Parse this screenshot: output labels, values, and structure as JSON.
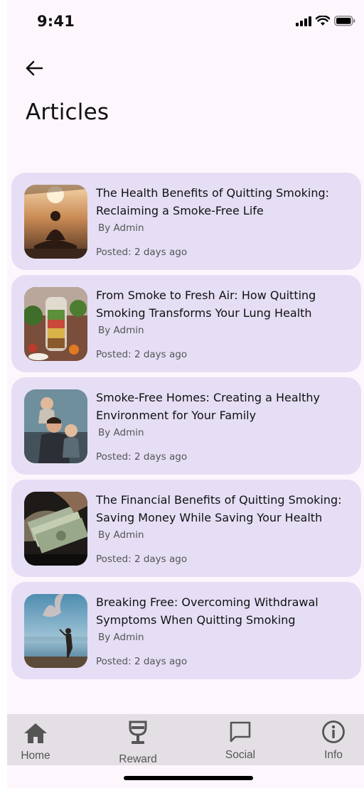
{
  "status_bar": {
    "time": "9:41"
  },
  "header": {
    "title": "Articles"
  },
  "articles": [
    {
      "title": "The Health Benefits of Quitting Smoking: Reclaiming a Smoke-Free Life",
      "author": "By Admin",
      "posted": "Posted: 2 days ago",
      "image": "meditation-sunset-photo"
    },
    {
      "title": "From Smoke to Fresh Air: How Quitting Smoking Transforms Your Lung Health",
      "author": "By Admin",
      "posted": "Posted: 2 days ago",
      "image": "salad-jar-photo"
    },
    {
      "title": "Smoke-Free Homes: Creating a Healthy Environment for Your Family",
      "author": "By Admin",
      "posted": "Posted: 2 days ago",
      "image": "family-photo"
    },
    {
      "title": "The Financial Benefits of Quitting Smoking: Saving Money While Saving Your Health",
      "author": "By Admin",
      "posted": "Posted: 2 days ago",
      "image": "money-in-hands-photo"
    },
    {
      "title": "Breaking Free: Overcoming Withdrawal Symptoms When Quitting Smoking",
      "author": "By Admin",
      "posted": "Posted: 2 days ago",
      "image": "woman-by-lake-photo"
    }
  ],
  "bottom_nav": {
    "home": {
      "label": "Home",
      "icon": "home-icon"
    },
    "reward": {
      "label": "Reward",
      "icon": "trophy-icon"
    },
    "social": {
      "label": "Social",
      "icon": "chat-bubble-icon"
    },
    "info": {
      "label": "Info",
      "icon": "info-icon"
    }
  },
  "colors": {
    "background": "#fdf7fd",
    "card": "#e6def5",
    "nav": "#e4dfe5"
  }
}
